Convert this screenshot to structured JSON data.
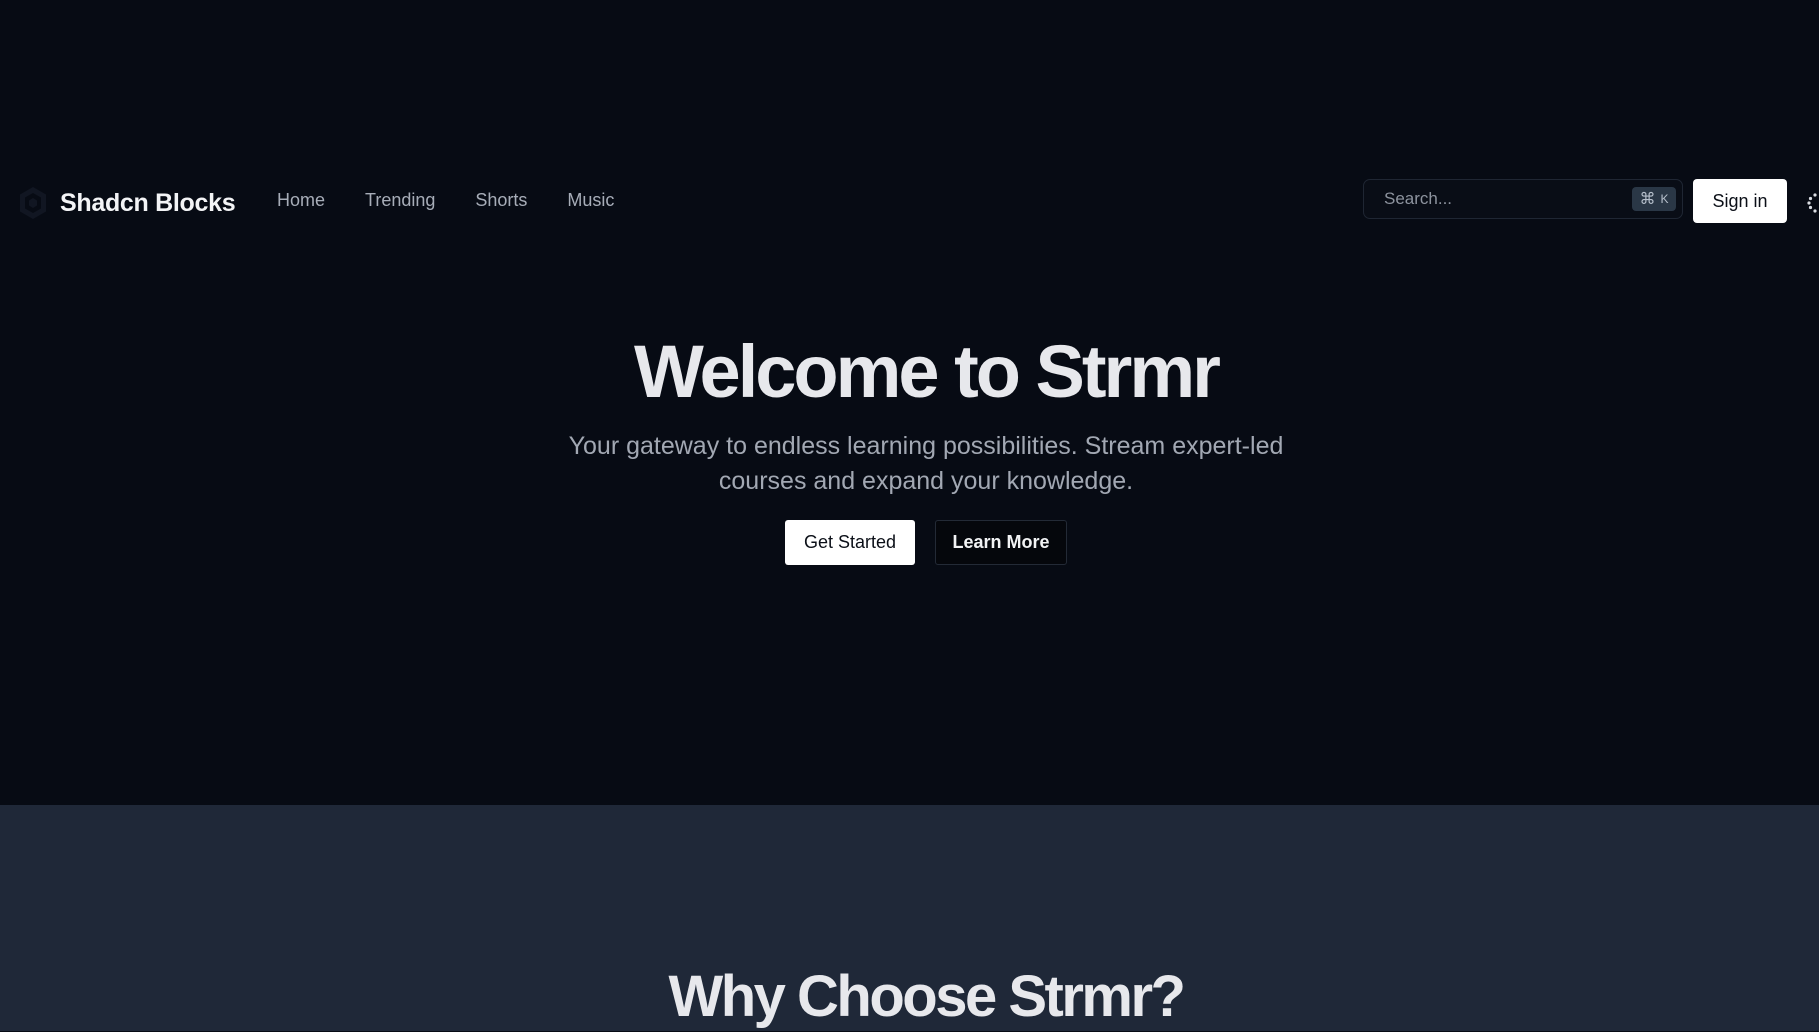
{
  "brand": {
    "name": "Shadcn Blocks",
    "logo_icon": "shadcn-hexagon-logo-icon"
  },
  "nav": {
    "items": [
      {
        "label": "Home"
      },
      {
        "label": "Trending"
      },
      {
        "label": "Shorts"
      },
      {
        "label": "Music"
      }
    ]
  },
  "search": {
    "placeholder": "Search...",
    "value": "",
    "shortcut_symbol": "⌘",
    "shortcut_key": "K"
  },
  "header": {
    "signin_label": "Sign in",
    "trailing_icon": "loader-icon"
  },
  "hero": {
    "title": "Welcome to Strmr",
    "subtitle": "Your gateway to endless learning possibilities. Stream expert-led courses and expand your knowledge.",
    "primary_cta": "Get Started",
    "secondary_cta": "Learn More"
  },
  "features": {
    "title": "Why Choose Strmr?"
  },
  "colors": {
    "hero_background": "#070b14",
    "features_background": "#1f2838",
    "text_primary": "#e7e8ec",
    "text_muted": "#a2a8b3",
    "button_primary": "#ffffff"
  }
}
